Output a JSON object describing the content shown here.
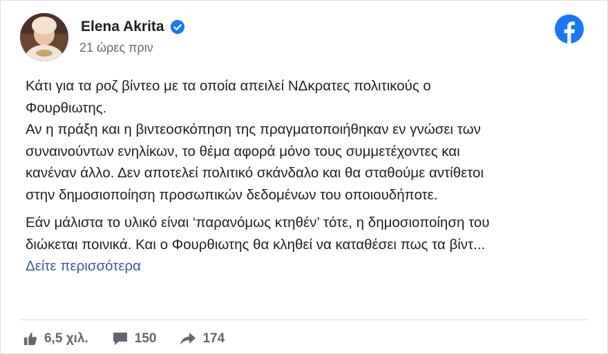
{
  "post": {
    "author": "Elena Akrita",
    "verified": true,
    "timestamp": "21 ώρες πριν",
    "paragraph1": "Κάτι για τα ροζ βίντεο με τα οποία απειλεί ΝΔκρατες πολιτικούς ο\nΦουρθιωτης.\nΑν η πράξη και η βιντεοσκόπηση της πραγματοποιήθηκαν εν γνώσει των\nσυναινούντων ενηλίκων, το θέμα αφορά μόνο τους συμμετέχοντες και\nκανέναν άλλο. Δεν αποτελεί πολιτικό σκάνδαλο και θα σταθούμε αντίθετοι\nστην δημοσιοποίηση προσωπικών δεδομένων του οποιουδήποτε.",
    "paragraph2": "Εάν μάλιστα το υλικό είναι ‘παρανόμως κτηθέν’ τότε, η δημοσιοποίηση του\nδιώκεται ποινικά. Και ο Φουρθιωτης θα κληθεί να καταθέσει πως τα βίντ...",
    "see_more": "Δείτε περισσότερα"
  },
  "stats": {
    "likes": "6,5 χιλ.",
    "comments": "150",
    "shares": "174"
  },
  "colors": {
    "facebook_blue": "#1877f2",
    "link": "#385898",
    "muted": "#65676b"
  },
  "icons": {
    "verified": "verified-badge-icon",
    "facebook": "facebook-logo-icon",
    "like": "thumbs-up-icon",
    "comment": "speech-bubble-icon",
    "share": "share-arrow-icon"
  }
}
